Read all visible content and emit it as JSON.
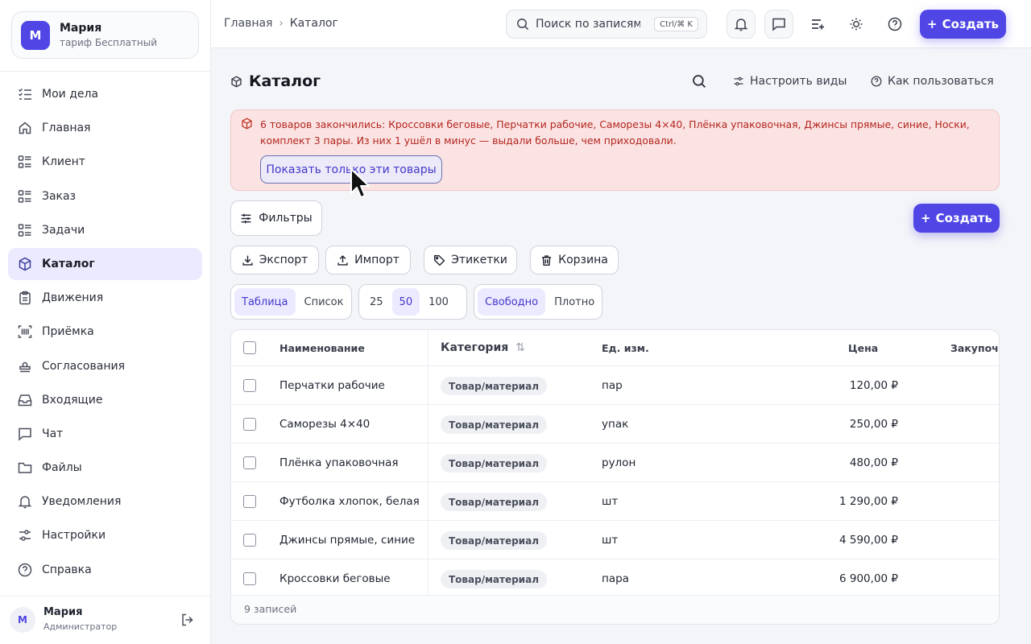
{
  "org": {
    "avatar": "М",
    "name": "Мария",
    "plan": "тариф Бесплатный"
  },
  "sidebar": {
    "items": [
      {
        "label": "Мои дела",
        "icon": "checklist-icon"
      },
      {
        "label": "Главная",
        "icon": "home-icon"
      },
      {
        "label": "Клиент",
        "icon": "list-icon"
      },
      {
        "label": "Заказ",
        "icon": "list-icon"
      },
      {
        "label": "Задачи",
        "icon": "list-icon"
      },
      {
        "label": "Каталог",
        "icon": "cube-icon",
        "active": true
      },
      {
        "label": "Движения",
        "icon": "clipboard-icon"
      },
      {
        "label": "Приёмка",
        "icon": "barcode-icon"
      },
      {
        "label": "Согласования",
        "icon": "stamp-icon"
      },
      {
        "label": "Входящие",
        "icon": "inbox-icon"
      },
      {
        "label": "Чат",
        "icon": "chat-icon"
      },
      {
        "label": "Файлы",
        "icon": "folder-icon"
      },
      {
        "label": "Уведомления",
        "icon": "bell-icon"
      },
      {
        "label": "Настройки",
        "icon": "sliders-icon"
      },
      {
        "label": "Справка",
        "icon": "help-icon"
      }
    ]
  },
  "user": {
    "avatar": "М",
    "name": "Мария",
    "role": "Администратор"
  },
  "topbar": {
    "crumbs": [
      "Главная",
      "Каталог"
    ],
    "search_placeholder": "Поиск по записям",
    "search_kbd": "Ctrl/⌘ K",
    "create_label": "Создать"
  },
  "page": {
    "title": "Каталог",
    "configure_views": "Настроить виды",
    "how_to_use": "Как пользоваться"
  },
  "alert": {
    "text": "6 товаров закончились: Кроссовки беговые, Перчатки рабочие, Саморезы 4×40, Плёнка упаковочная, Джинсы прямые, синие, Носки, комплект 3 пары. Из них 1 ушёл в минус — выдали больше, чем приходовали.",
    "button": "Показать только эти товары"
  },
  "toolbar": {
    "filters": "Фильтры",
    "create": "Создать",
    "export": "Экспорт",
    "import": "Импорт",
    "labels": "Этикетки",
    "trash": "Корзина"
  },
  "view_toggle": {
    "options": [
      "Таблица",
      "Список"
    ],
    "selected": "Таблица"
  },
  "page_size": {
    "options": [
      "25",
      "50",
      "100"
    ],
    "selected": "50"
  },
  "density": {
    "options": [
      "Свободно",
      "Плотно"
    ],
    "selected": "Свободно"
  },
  "table": {
    "columns": [
      "Наименование",
      "Категория",
      "Ед. изм.",
      "Цена",
      "Закупочна"
    ],
    "rows": [
      {
        "name": "Перчатки рабочие",
        "category": "Товар/материал",
        "unit": "пар",
        "price": "120,00 ₽"
      },
      {
        "name": "Саморезы 4×40",
        "category": "Товар/материал",
        "unit": "упак",
        "price": "250,00 ₽"
      },
      {
        "name": "Плёнка упаковочная",
        "category": "Товар/материал",
        "unit": "рулон",
        "price": "480,00 ₽"
      },
      {
        "name": "Футболка хлопок, белая",
        "category": "Товар/материал",
        "unit": "шт",
        "price": "1 290,00 ₽"
      },
      {
        "name": "Джинсы прямые, синие",
        "category": "Товар/материал",
        "unit": "шт",
        "price": "4 590,00 ₽"
      },
      {
        "name": "Кроссовки беговые",
        "category": "Товар/материал",
        "unit": "пара",
        "price": "6 900,00 ₽"
      }
    ],
    "footer": "9 записей"
  }
}
